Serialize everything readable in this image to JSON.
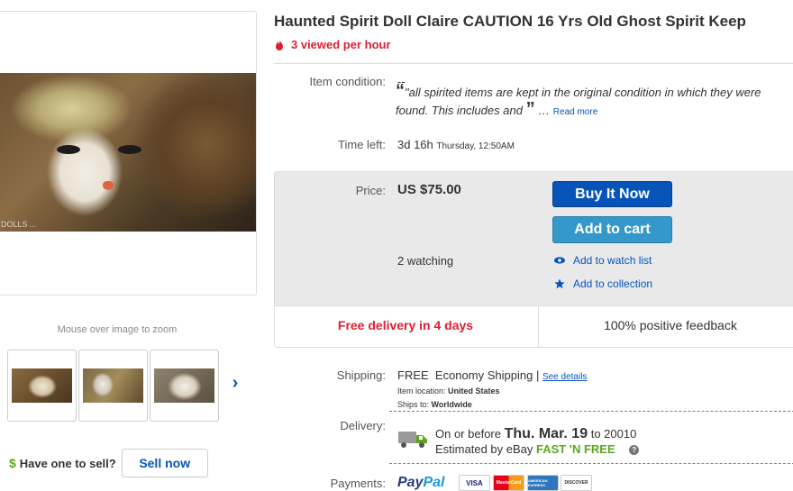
{
  "listing": {
    "title": "Haunted Spirit Doll Claire CAUTION 16 Yrs Old Ghost Spirit Keep",
    "views_per_hour": "3 viewed per hour"
  },
  "gallery": {
    "zoom_hint": "Mouse over image to zoom",
    "photo_watermark": "DOLLS ...",
    "next_icon": "chevron-right-icon"
  },
  "sell": {
    "prompt": "Have one to sell?",
    "button_label": "Sell now",
    "dollar_symbol": "$"
  },
  "condition": {
    "label": "Item condition:",
    "value": "--",
    "quote": "\"all spirited items are kept in the original condition in which they were found. This includes and",
    "read_more": "Read more"
  },
  "time_left": {
    "label": "Time left:",
    "value": "3d 16h",
    "end_time": "Thursday, 12:50AM"
  },
  "buy_box": {
    "price_label": "Price:",
    "price": "US $75.00",
    "buy_now_label": "Buy It Now",
    "add_to_cart_label": "Add to cart",
    "watching": "2 watching",
    "watch_list_link": "Add to watch list",
    "collection_link": "Add to collection",
    "free_delivery": "Free delivery in 4 days",
    "feedback": "100% positive feedback"
  },
  "shipping": {
    "label": "Shipping:",
    "cost": "FREE",
    "method": "Economy Shipping",
    "separator": "|",
    "see_details": "See details",
    "item_location_label": "Item location:",
    "item_location": "United States",
    "ships_to_label": "Ships to:",
    "ships_to": "Worldwide"
  },
  "delivery": {
    "label": "Delivery:",
    "prefix": "On or before",
    "date": "Thu. Mar. 19",
    "suffix": "to 20010",
    "estimate": "Estimated by eBay",
    "fast_free": "FAST 'N FREE"
  },
  "payments": {
    "label": "Payments:",
    "paypal_a": "Pay",
    "paypal_b": "Pal",
    "cards": [
      "VISA",
      "MasterCard",
      "AMERICAN EXPRESS",
      "DISCOVER"
    ]
  },
  "colors": {
    "primary_blue": "#0654ba",
    "secondary_blue": "#3498ca",
    "alert_red": "#dd1e31",
    "green": "#5ba71b"
  }
}
